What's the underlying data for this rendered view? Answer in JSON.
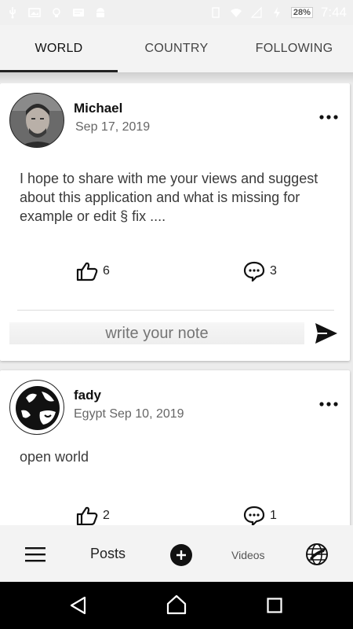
{
  "status_bar": {
    "battery": "28%",
    "time": "7:44",
    "icons": [
      "usb-icon",
      "image-icon",
      "bulb-icon",
      "message-icon",
      "android-icon",
      "clipboard-icon",
      "wifi-icon",
      "signal-icon",
      "charging-icon",
      "battery-icon"
    ]
  },
  "tabs": [
    {
      "label": "WORLD",
      "active": true
    },
    {
      "label": "COUNTRY",
      "active": false
    },
    {
      "label": "FOLLOWING",
      "active": false
    }
  ],
  "posts": [
    {
      "author": "Michael",
      "meta": "Sep 17, 2019",
      "text": "I hope to share with me your views and suggest about this application and what is missing for example or edit § fix ....",
      "likes": "6",
      "comments": "3",
      "note_placeholder": "write your note"
    },
    {
      "author": "fady",
      "meta": "Egypt Sep 10, 2019",
      "text": "open world",
      "likes": "2",
      "comments": "1"
    }
  ],
  "bottom_bar": {
    "posts_label": "Posts",
    "videos_label": "Videos"
  },
  "colors": {
    "tab_indicator": "#222222",
    "nav_bar": "#000000",
    "card": "#ffffff"
  }
}
